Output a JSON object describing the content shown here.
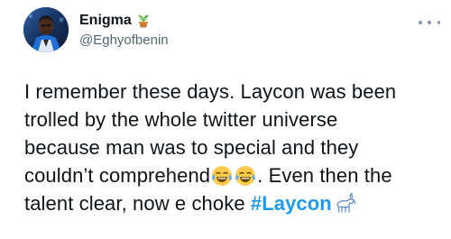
{
  "tweet": {
    "author": {
      "display_name": "Enigma",
      "handle": "@Eghyofbenin",
      "name_emoji": "potted-plant-icon"
    },
    "body": {
      "line1": "I remember these days. Laycon was been",
      "line2": "trolled by the whole twitter universe",
      "line3": "because man was to special and they",
      "line4_before": "couldn’t comprehend",
      "line4_after": ". Even then the",
      "line5_before": "talent clear, now e choke ",
      "hashtag": "#Laycon",
      "emojis": [
        "face-with-tears-of-joy-icon",
        "face-with-tears-of-joy-icon"
      ],
      "hashtag_emoji": "goat-icon"
    }
  },
  "colors": {
    "text": "#0f1419",
    "secondary": "#536471",
    "hashtag": "#1d9bf0"
  }
}
